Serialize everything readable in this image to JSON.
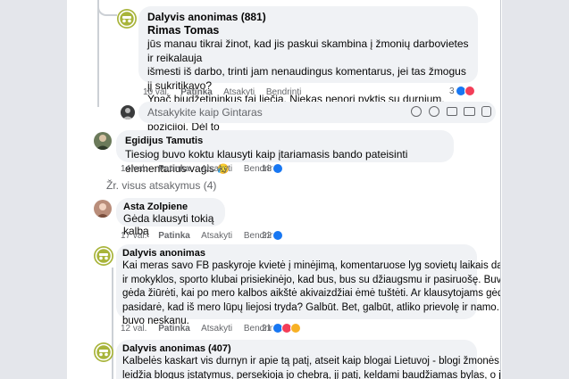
{
  "comments": [
    {
      "author": "Dalyvis anonimas (881)",
      "reply_to": "Rimas Tomas",
      "text_lines": [
        "jūs manau tikrai žinot, kad jis paskui skambina į žmonių darbovietes ir reikalauja",
        "išmesti iš darbo, trinti jam nenaudingus komentarus, jei tas žmogus jį sukritikavo?",
        "Ypač biudžetininkus tai liečia. Niekas nenori pyktis su durnium, ypač tokioj galios",
        "pozicijoj. Dėl to"
      ],
      "time": "10 val.",
      "like": "Patinka",
      "reply": "Atsakyti",
      "share": "Bendrinti",
      "reactions": "3",
      "avatar_icon": "anonymous-avatar-icon"
    },
    {
      "author": "Egidijus Tamutis",
      "text": "Tiesiog buvo koktu klausyti kaip įtariamasis bando pateisinti elementarius vagis",
      "emoji": "😥",
      "time": "14 val.",
      "like": "Patinka",
      "reply": "Atsakyti",
      "share": "Bendrinti",
      "reactions": "18"
    },
    {
      "author": "Asta Zolpiene",
      "text": "Gėda klausyti tokią kalbą",
      "time": "17 val.",
      "like": "Patinka",
      "reply": "Atsakyti",
      "share": "Bendrinti",
      "reactions": "22"
    },
    {
      "author": "Dalyvis anonimas",
      "text_lines": [
        "Kai meras savo FB paskyroje kvietė į minėjimą, komentaruose lyg sovietų laikais darželiai",
        "ir mokyklos, sporto klubai prisiekinėjo, kad bus, bus su džiaugsmu ir pasiruošę. Buvo",
        "gėda žiūrėti, kai po mero kalbos aikštė akivaizdžiai ėmė tuštėti. Ar klausytojams gėda",
        "pasidarė, kad iš mero lūpų liejosi tryda? Galbūt. Bet, galbūt, atliko prievolę ir namo. Man",
        "buvo neskanu."
      ],
      "time": "12 val.",
      "like": "Patinka",
      "reply": "Atsakyti",
      "share": "Bendrinti",
      "reactions": "21"
    },
    {
      "author": "Dalyvis anonimas (407)",
      "text_lines": [
        "Kalbelės kaskart vis durnyn ir apie tą patį, atseit kaip blogai Lietuvoj - blogi žmonės",
        "leidžia blogus įstatymus, persekioja jo chebrą, jį patį, keldami baudžiamas bylas, o jis"
      ]
    }
  ],
  "reply_input": {
    "placeholder": "Atsakykite kaip Gintaras"
  },
  "view_replies": "Žr. visus atsakymus (4)",
  "colors": {
    "like": "#1877f2",
    "angry": "#f33e58",
    "anon_avatar": "#a8b43a"
  }
}
